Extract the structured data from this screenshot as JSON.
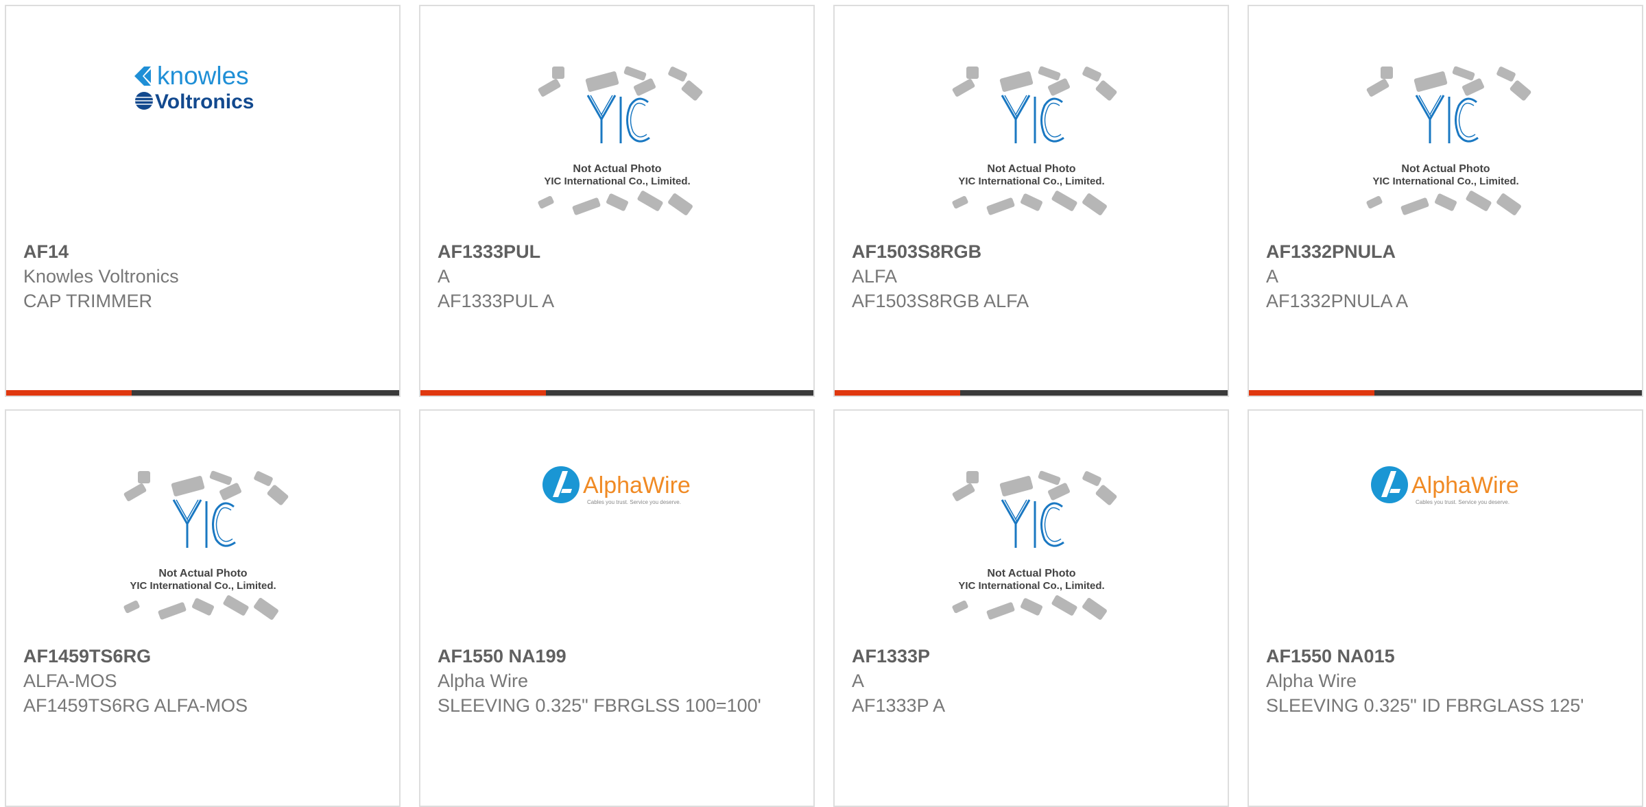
{
  "colors": {
    "accent": "#e0380f",
    "bar": "#3a3a3a",
    "border": "#dddddd",
    "title": "#606060",
    "text": "#777777"
  },
  "products": [
    {
      "part_number": "AF14",
      "manufacturer": "Knowles Voltronics",
      "description": "CAP TRIMMER",
      "image": "knowles-voltronics-logo",
      "logo_text_1": "knowles",
      "logo_text_2": "Voltronics"
    },
    {
      "part_number": "AF1333PUL",
      "manufacturer": "A",
      "description": "AF1333PUL A",
      "image": "yic-placeholder",
      "logo_text_1": "Not Actual Photo",
      "logo_text_2": "YIC International Co., Limited."
    },
    {
      "part_number": "AF1503S8RGB",
      "manufacturer": "ALFA",
      "description": "AF1503S8RGB ALFA",
      "image": "yic-placeholder",
      "logo_text_1": "Not Actual Photo",
      "logo_text_2": "YIC International Co., Limited."
    },
    {
      "part_number": "AF1332PNULA",
      "manufacturer": "A",
      "description": "AF1332PNULA A",
      "image": "yic-placeholder",
      "logo_text_1": "Not Actual Photo",
      "logo_text_2": "YIC International Co., Limited."
    },
    {
      "part_number": "AF1459TS6RG",
      "manufacturer": "ALFA-MOS",
      "description": "AF1459TS6RG ALFA-MOS",
      "image": "yic-placeholder",
      "logo_text_1": "Not Actual Photo",
      "logo_text_2": "YIC International Co., Limited."
    },
    {
      "part_number": "AF1550 NA199",
      "manufacturer": "Alpha Wire",
      "description": "SLEEVING 0.325\" FBRGLSS 100=100'",
      "image": "alphawire-logo",
      "logo_text_1": "AlphaWire",
      "logo_text_2": "Cables you trust. Service you deserve."
    },
    {
      "part_number": "AF1333P",
      "manufacturer": "A",
      "description": "AF1333P A",
      "image": "yic-placeholder",
      "logo_text_1": "Not Actual Photo",
      "logo_text_2": "YIC International Co., Limited."
    },
    {
      "part_number": "AF1550 NA015",
      "manufacturer": "Alpha Wire",
      "description": "SLEEVING 0.325\" ID FBRGLASS 125'",
      "image": "alphawire-logo",
      "logo_text_1": "AlphaWire",
      "logo_text_2": "Cables you trust. Service you deserve."
    }
  ]
}
